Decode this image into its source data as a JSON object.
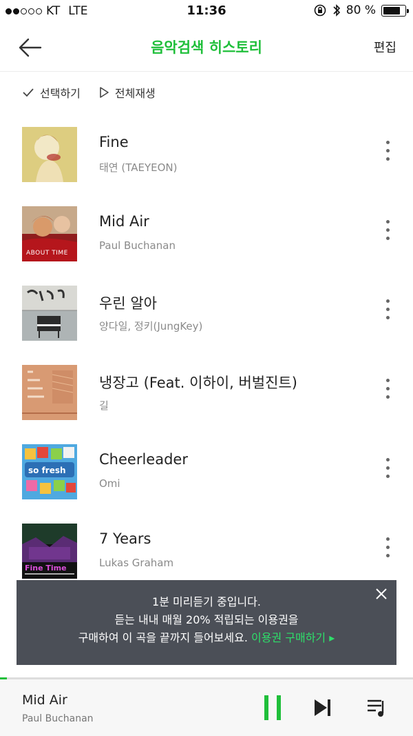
{
  "status_bar": {
    "carrier": "KT",
    "network": "LTE",
    "time": "11:36",
    "battery": "80 %",
    "battery_level": 0.8,
    "signal_filled": 2,
    "signal_total": 5
  },
  "header": {
    "title": "음악검색 히스토리",
    "edit_label": "편집",
    "back_icon": "arrow-left-icon"
  },
  "toolbar": {
    "select_label": "선택하기",
    "play_all_label": "전체재생"
  },
  "songs": [
    {
      "title": "Fine",
      "artist": "태연 (TAEYEON)"
    },
    {
      "title": "Mid Air",
      "artist": "Paul Buchanan"
    },
    {
      "title": "우린 알아",
      "artist": "양다일, 정키(JungKey)"
    },
    {
      "title": "냉장고  (Feat. 이하이, 버벌진트)",
      "artist": "길"
    },
    {
      "title": "Cheerleader",
      "artist": "Omi"
    },
    {
      "title": "7 Years",
      "artist": "Lukas Graham"
    }
  ],
  "toast": {
    "line1": "1분 미리듣기 중입니다.",
    "line2": "듣는 내내 매월 20% 적립되는 이용권을",
    "line3_text": "구매하여 이 곡을 끝까지 들어보세요.",
    "line3_link": "이용권 구매하기 ▸"
  },
  "player": {
    "title": "Mid Air",
    "artist": "Paul Buchanan",
    "progress": 0.017
  },
  "colors": {
    "accent": "#1fbf3a",
    "toast_bg": "#4b4f57",
    "toast_link": "#2ee06a"
  }
}
